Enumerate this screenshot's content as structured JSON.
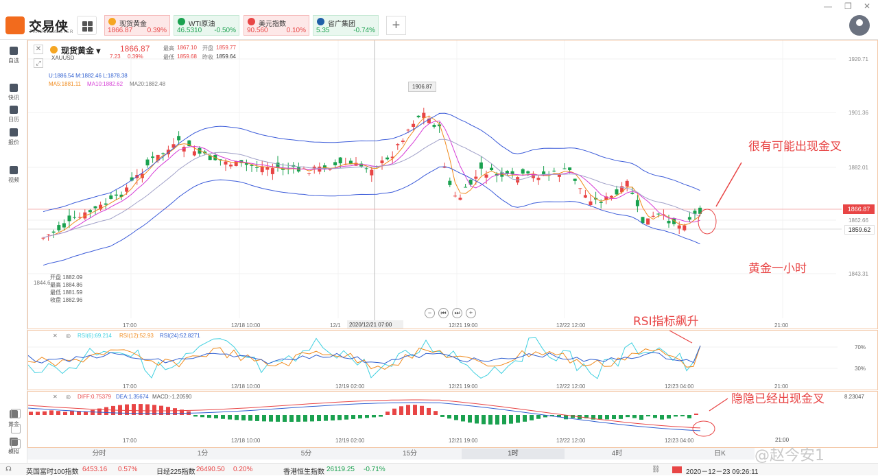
{
  "app": {
    "name": "交易侠",
    "subtitle": "TRADER MASTER"
  },
  "tickers": [
    {
      "name": "现货黄金",
      "price": "1866.87",
      "change": "0.39%",
      "color": "#f5a623"
    },
    {
      "name": "WTI原油",
      "price": "46.5310",
      "change": "-0.50%",
      "color": "#1aa14f"
    },
    {
      "name": "美元指数",
      "price": "90.560",
      "change": "0.10%",
      "color": "#e84545"
    },
    {
      "name": "省广集团",
      "price": "5.35",
      "change": "-0.74%",
      "color": "#1f5fa8"
    }
  ],
  "sidebar": [
    {
      "label": "自选",
      "icon": "bookmark-icon"
    },
    {
      "label": "快讯",
      "icon": "news-icon"
    },
    {
      "label": "日历",
      "icon": "calendar-icon"
    },
    {
      "label": "报价",
      "icon": "quote-icon"
    },
    {
      "label": "视频",
      "icon": "video-icon"
    }
  ],
  "sidebar_bottom": [
    {
      "label": "黄金"
    },
    {
      "label": "模拟"
    }
  ],
  "main": {
    "symbol": "现货黄金",
    "code": "XAUUSD",
    "price": "1866.87",
    "change": "7.23",
    "change_pct": "0.39%",
    "high_label": "最高",
    "high": "1867.10",
    "open_label": "开盘",
    "open": "1859.77",
    "low_label": "最低",
    "low": "1859.68",
    "prev_label": "昨收",
    "prev": "1859.64",
    "boll": "U:1886.54  M:1882.46  L:1878.38",
    "ma5": "MA5:1881.11",
    "ma10": "MA10:1882.62",
    "ma20": "MA20:1882.48",
    "tooltip_high": "1906.87",
    "crosshair_time": "2020/12/21 07:00",
    "ohlc_open": "开盘 1882.09",
    "ohlc_high": "最高 1884.86",
    "ohlc_low": "最低 1881.59",
    "ohlc_close": "收盘 1882.96",
    "left_price": "1844.6",
    "y_ticks": [
      "1920.71",
      "1901.36",
      "1882.01",
      "1862.66",
      "1843.31"
    ],
    "x_ticks": [
      "17:00",
      "12/18 10:00",
      "12/1",
      "12/21 19:00",
      "12/22 12:00",
      "21:00"
    ],
    "current_tag": "1866.87",
    "alert_tag": "1859.62"
  },
  "rsi": {
    "rsi6": "RSI(6):69.214",
    "rsi12": "RSI(12):52.93",
    "rsi24": "RSI(24):52.8271",
    "y_ticks": [
      "70%",
      "30%"
    ],
    "x_ticks": [
      "17:00",
      "12/18 10:00",
      "12/19 02:00",
      "12/21 19:00",
      "12/22 12:00",
      "12/23 04:00",
      "21:00"
    ]
  },
  "macd": {
    "diff": "DIFF:0.75379",
    "dea": "DEA:1.35674",
    "macd": "MACD:-1.20590",
    "y_tick": "8.23047",
    "x_ticks": [
      "17:00",
      "12/18 10:00",
      "12/19 02:00",
      "12/21 19:00",
      "12/22 12:00",
      "12/23 04:00"
    ]
  },
  "annotations": {
    "golden_cross": "很有可能出现金叉",
    "gold_hourly": "黄金一小时",
    "rsi_up": "RSI指标飙升",
    "macd_cross": "隐隐已经出现金叉"
  },
  "timeframes": [
    "分时",
    "1分",
    "5分",
    "15分",
    "1时",
    "4时",
    "日K"
  ],
  "active_timeframe": "1时",
  "status": {
    "items": [
      {
        "name": "英国富时100指数",
        "value": "6453.16",
        "change": "0.57%"
      },
      {
        "name": "日经225指数",
        "value": "26490.50",
        "change": "0.20%"
      },
      {
        "name": "香港恒生指数",
        "value": "26119.25",
        "change": "-0.71%"
      }
    ],
    "datetime": "2020－12－23 09:26:11",
    "time_clock": "21:00"
  },
  "watermark": "@赵今安1",
  "colors": {
    "up": "#e84545",
    "down": "#1aa14f",
    "accent": "#f26b1d"
  }
}
